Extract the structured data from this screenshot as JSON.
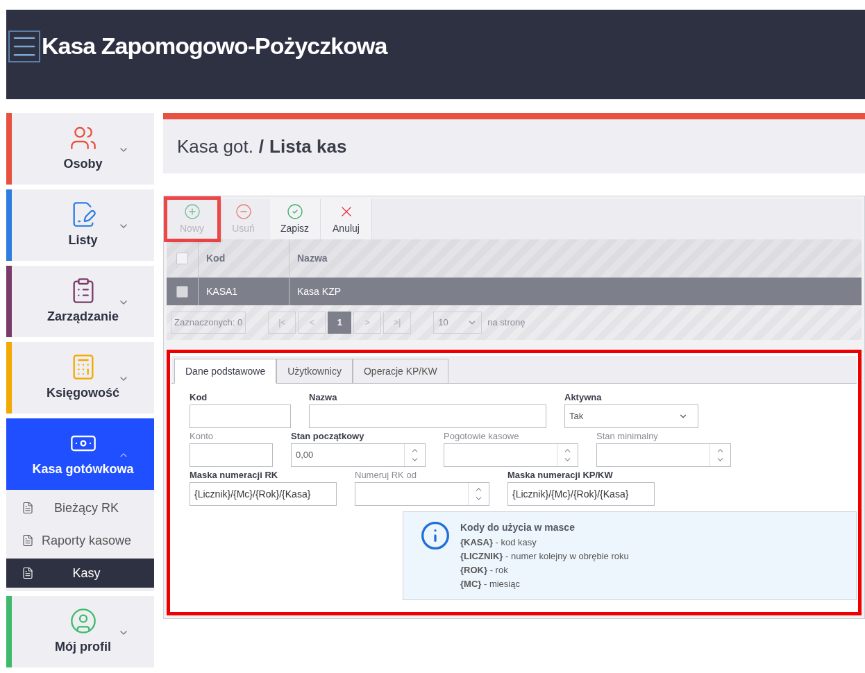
{
  "app": {
    "title": "Kasa Zapomogowo-Pożyczkowa"
  },
  "sidebar": {
    "items": [
      {
        "label": "Osoby",
        "kind": "people",
        "color": "#e8513f",
        "expanded": false,
        "selected": false
      },
      {
        "label": "Listy",
        "kind": "edit",
        "color": "#2f7de1",
        "expanded": false,
        "selected": false
      },
      {
        "label": "Zarządzanie",
        "kind": "settings-doc",
        "color": "#7a3b6b",
        "expanded": false,
        "selected": false
      },
      {
        "label": "Księgowość",
        "kind": "calculator",
        "color": "#f2a900",
        "expanded": false,
        "selected": false
      },
      {
        "label": "Kasa gotówkowa",
        "kind": "money",
        "color": "#1f4fff",
        "expanded": true,
        "selected": true,
        "children": [
          {
            "label": "Bieżący RK",
            "selected": false
          },
          {
            "label": "Raporty kasowe",
            "selected": false
          },
          {
            "label": "Kasy",
            "selected": true
          }
        ]
      },
      {
        "label": "Mój profil",
        "kind": "profile",
        "color": "#3dbb6b",
        "expanded": false,
        "selected": false
      }
    ]
  },
  "breadcrumb": {
    "parent": "Kasa got.",
    "separator": "/",
    "current": "Lista kas"
  },
  "toolbar": [
    {
      "label": "Nowy",
      "kind": "add",
      "disabled": true,
      "highlighted": true
    },
    {
      "label": "Usuń",
      "kind": "delete",
      "disabled": true,
      "highlighted": false
    },
    {
      "label": "Zapisz",
      "kind": "save",
      "disabled": false,
      "highlighted": false
    },
    {
      "label": "Anuluj",
      "kind": "cancel",
      "disabled": false,
      "highlighted": false
    }
  ],
  "table": {
    "header_checked": false,
    "columns": [
      "Kod",
      "Nazwa"
    ],
    "rows": [
      {
        "cells": [
          "KASA1",
          "Kasa KZP"
        ],
        "checked": false,
        "selected": true
      }
    ]
  },
  "pager": {
    "selected_count": "Zaznaczonych: 0",
    "first": "|<",
    "prev": "<",
    "pages": [
      {
        "label": "1",
        "selected": true
      }
    ],
    "next": ">",
    "last": ">|",
    "page_size": "10",
    "page_size_label": "na stronę"
  },
  "details": {
    "highlighted": true,
    "tabs": [
      {
        "label": "Dane podstawowe",
        "selected": true
      },
      {
        "label": "Użytkownicy",
        "selected": false
      },
      {
        "label": "Operacje KP/KW",
        "selected": false
      }
    ],
    "rows": [
      [
        {
          "label": "Kod",
          "required": true,
          "kind": "text"
        },
        {
          "label": "Nazwa",
          "required": true,
          "kind": "text"
        },
        {
          "label": "Aktywna",
          "required": true,
          "kind": "select",
          "value": "Tak"
        }
      ],
      [
        {
          "label": "Konto",
          "required": false,
          "kind": "text"
        },
        {
          "label": "Stan początkowy",
          "required": true,
          "kind": "number",
          "value": "0,00"
        },
        {
          "label": "Pogotowie kasowe",
          "required": false,
          "kind": "number"
        },
        {
          "label": "Stan minimalny",
          "required": false,
          "kind": "number"
        }
      ],
      [
        {
          "label": "Maska numeracji RK",
          "required": true,
          "kind": "text",
          "value": "{Licznik}/{Mc}/{Rok}/{Kasa}"
        },
        {
          "label": "Numeruj RK od",
          "required": false,
          "kind": "number"
        },
        {
          "label": "Maska numeracji KP/KW",
          "required": true,
          "kind": "text",
          "value": "{Licznik}/{Mc}/{Rok}/{Kasa}"
        }
      ]
    ],
    "info": {
      "title": "Kody do użycia w masce",
      "lines": [
        "**{KASA}** - kod kasy",
        "**{LICZNIK}** - numer kolejny w obrębie roku",
        "**{ROK}** - rok",
        "**{MC}** - miesiąc"
      ]
    }
  }
}
